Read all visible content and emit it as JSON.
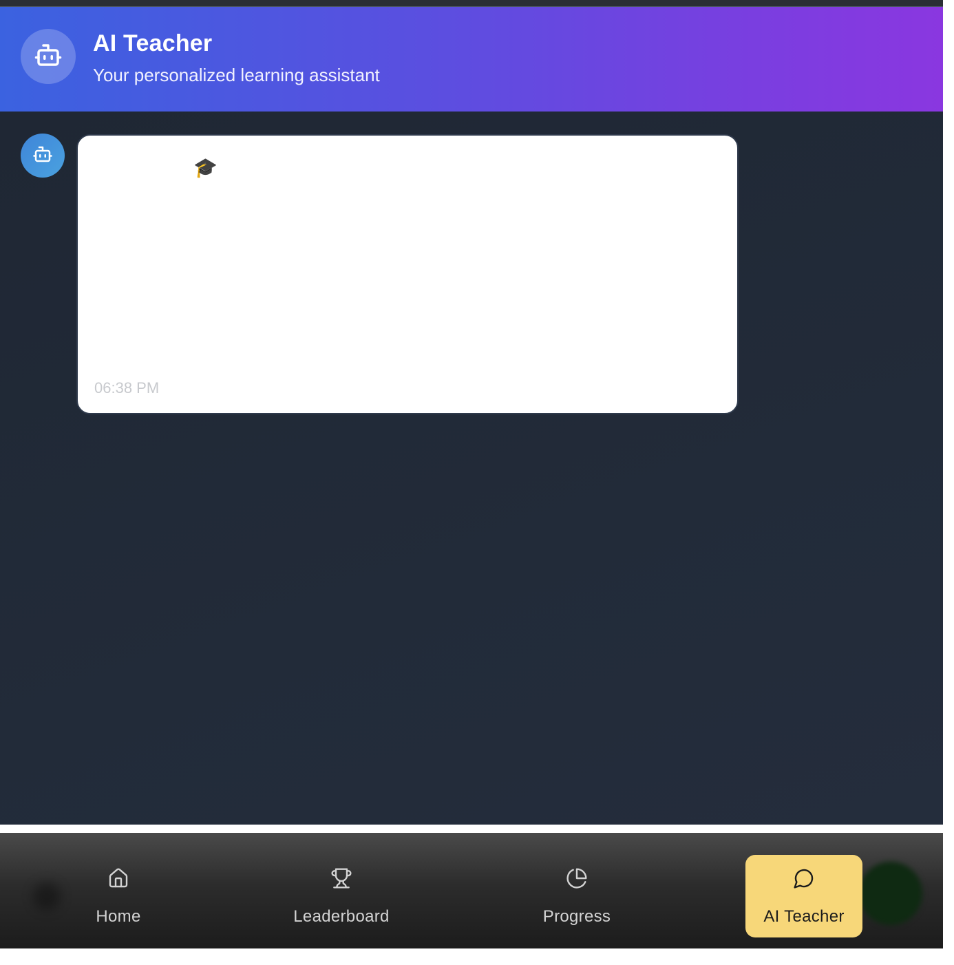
{
  "header": {
    "title": "AI Teacher",
    "subtitle": "Your personalized learning assistant",
    "avatar_icon": "robot-icon",
    "gradient_start": "#3b62e0",
    "gradient_end": "#8a37e0"
  },
  "chat": {
    "messages": [
      {
        "sender": "bot",
        "avatar_icon": "robot-icon",
        "emoji": "🎓",
        "time": "06:38 PM"
      }
    ]
  },
  "bottom_nav": {
    "items": [
      {
        "label": "Home",
        "icon": "home-icon",
        "active": false
      },
      {
        "label": "Leaderboard",
        "icon": "trophy-icon",
        "active": false
      },
      {
        "label": "Progress",
        "icon": "pie-chart-icon",
        "active": false
      },
      {
        "label": "AI Teacher",
        "icon": "chat-bubble-icon",
        "active": true
      }
    ],
    "active_color": "#f7d779"
  }
}
